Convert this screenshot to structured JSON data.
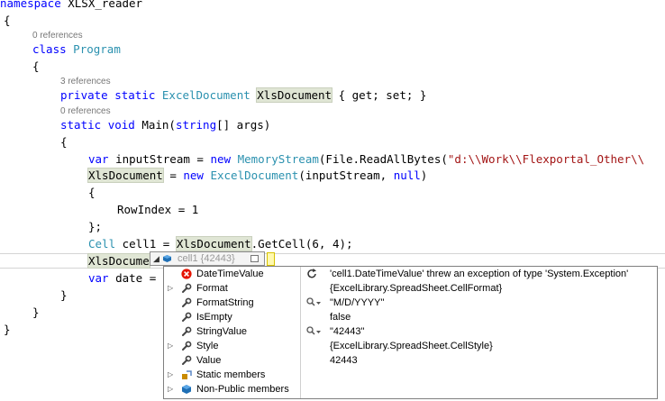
{
  "editor": {
    "lines": [
      {
        "parts": [
          [
            "kw",
            "namespace"
          ],
          [
            "",
            "XLSX_reader"
          ]
        ]
      },
      {
        "parts": [
          [
            "",
            "{"
          ]
        ]
      },
      {
        "lens": "0 references"
      },
      {
        "parts": [
          [
            "kw",
            "class"
          ],
          [
            "",
            ""
          ],
          [
            "ty",
            "Program"
          ]
        ]
      },
      {
        "parts": [
          [
            "",
            "{"
          ]
        ]
      },
      {
        "lens": "3 references"
      },
      {
        "parts": [
          [
            "kw",
            "private"
          ],
          [
            "kw",
            "static"
          ],
          [
            "ty",
            "ExcelDocument"
          ]
        ]
      },
      {
        "lens": "0 references"
      }
    ],
    "namespace_kw": "namespace",
    "namespace_name": " XLSX_reader",
    "brace_open": "{",
    "brace_close": "}",
    "brace_close_semi": "};",
    "refs0": "0 references",
    "refs3": "3 references",
    "class_kw": "class",
    "class_name": "Program",
    "private_kw": "private",
    "static_kw": "static",
    "type_excel": "ExcelDocument",
    "prop_name": "XlsDocument",
    "prop_tail": " { get; set; }",
    "void_kw": "void",
    "main_sig": " Main(",
    "string_kw": "string",
    "main_args": "[] args)",
    "var_kw": "var",
    "input_stream": " inputStream = ",
    "new_kw": "new",
    "memory_stream": "MemoryStream",
    "file_read": "(File.ReadAllBytes(",
    "path_literal": "\"d:\\\\Work\\\\Flexportal_Other\\\\",
    "assign_new": " = ",
    "excel_ctor_args": "(inputStream, ",
    "null_kw": "null",
    "close_paren": ")",
    "row_index": "RowIndex = 1",
    "cell_type": "Cell",
    "cell_decl": " cell1 = ",
    "get_cell": ".GetCell(6, 4);",
    "xls_partial": "XlsDocume",
    "date_decl": " date = ",
    "date_rest": "",
    "close_brace_inner": "}"
  },
  "datatip": {
    "header_label": "cell1 {42443}",
    "rows": [
      {
        "name": "DateTimeValue",
        "icon": "error-icon",
        "value_icon": "refresh-icon",
        "value": "'cell1.DateTimeValue' threw an exception of type 'System.Exception'",
        "expandable": false
      },
      {
        "name": "Format",
        "icon": "wrench-icon",
        "value_icon": "",
        "value": "{ExcelLibrary.SpreadSheet.CellFormat}",
        "expandable": true
      },
      {
        "name": "FormatString",
        "icon": "wrench-icon",
        "value_icon": "magnifier-icon",
        "value": "\"M/D/YYYY\"",
        "expandable": false
      },
      {
        "name": "IsEmpty",
        "icon": "wrench-icon",
        "value_icon": "",
        "value": "false",
        "expandable": false
      },
      {
        "name": "StringValue",
        "icon": "wrench-icon",
        "value_icon": "magnifier-icon",
        "value": "\"42443\"",
        "expandable": false
      },
      {
        "name": "Style",
        "icon": "wrench-icon",
        "value_icon": "",
        "value": "{ExcelLibrary.SpreadSheet.CellStyle}",
        "expandable": true
      },
      {
        "name": "Value",
        "icon": "wrench-icon",
        "value_icon": "",
        "value": "42443",
        "expandable": false
      },
      {
        "name": "Static members",
        "icon": "static-members-icon",
        "value_icon": "",
        "value": "",
        "expandable": true
      },
      {
        "name": "Non-Public members",
        "icon": "non-public-icon",
        "value_icon": "",
        "value": "",
        "expandable": true
      }
    ]
  },
  "colors": {
    "keyword": "#0000ff",
    "type": "#2b91af",
    "string": "#a31515",
    "error": "#e51400"
  }
}
